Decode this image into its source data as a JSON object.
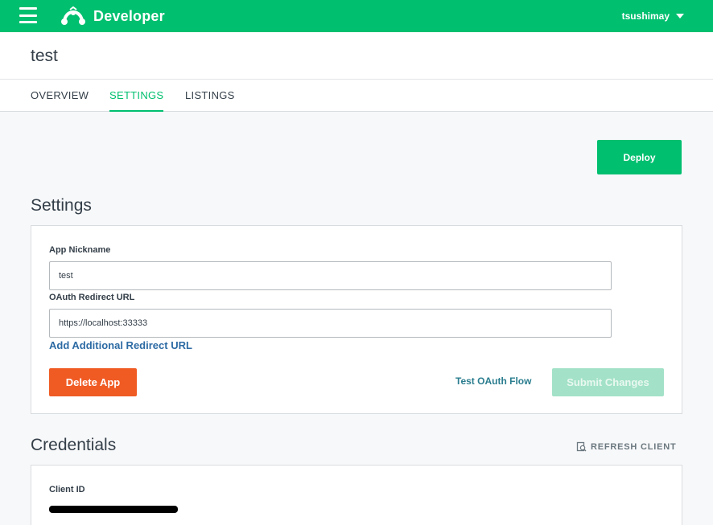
{
  "topbar": {
    "brand": "Developer",
    "user": "tsushimay"
  },
  "app": {
    "title": "test"
  },
  "tabs": [
    {
      "label": "OVERVIEW",
      "active": false
    },
    {
      "label": "SETTINGS",
      "active": true
    },
    {
      "label": "LISTINGS",
      "active": false
    }
  ],
  "deploy_label": "Deploy",
  "settings": {
    "title": "Settings",
    "nickname_label": "App Nickname",
    "nickname_value": "test",
    "redirect_label": "OAuth Redirect URL",
    "redirect_value": "https://localhost:33333",
    "add_redirect_label": "Add Additional Redirect URL",
    "delete_label": "Delete App",
    "test_oauth_label": "Test OAuth Flow",
    "submit_label": "Submit Changes"
  },
  "credentials": {
    "title": "Credentials",
    "refresh_label": "REFRESH CLIENT",
    "client_id_label": "Client ID"
  },
  "colors": {
    "brand_green": "#00bf6f",
    "delete_orange": "#f05b24",
    "link_blue": "#2d6ba4"
  }
}
